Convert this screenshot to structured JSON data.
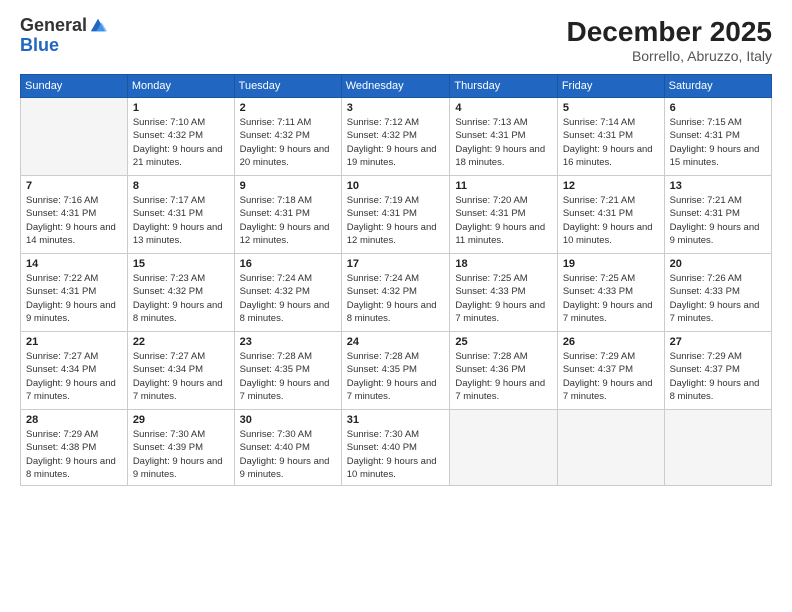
{
  "logo": {
    "general": "General",
    "blue": "Blue"
  },
  "header": {
    "month_year": "December 2025",
    "location": "Borrello, Abruzzo, Italy"
  },
  "weekdays": [
    "Sunday",
    "Monday",
    "Tuesday",
    "Wednesday",
    "Thursday",
    "Friday",
    "Saturday"
  ],
  "weeks": [
    [
      {
        "day": "",
        "empty": true
      },
      {
        "day": "1",
        "sunrise": "7:10 AM",
        "sunset": "4:32 PM",
        "daylight": "9 hours and 21 minutes."
      },
      {
        "day": "2",
        "sunrise": "7:11 AM",
        "sunset": "4:32 PM",
        "daylight": "9 hours and 20 minutes."
      },
      {
        "day": "3",
        "sunrise": "7:12 AM",
        "sunset": "4:32 PM",
        "daylight": "9 hours and 19 minutes."
      },
      {
        "day": "4",
        "sunrise": "7:13 AM",
        "sunset": "4:31 PM",
        "daylight": "9 hours and 18 minutes."
      },
      {
        "day": "5",
        "sunrise": "7:14 AM",
        "sunset": "4:31 PM",
        "daylight": "9 hours and 16 minutes."
      },
      {
        "day": "6",
        "sunrise": "7:15 AM",
        "sunset": "4:31 PM",
        "daylight": "9 hours and 15 minutes."
      }
    ],
    [
      {
        "day": "7",
        "sunrise": "7:16 AM",
        "sunset": "4:31 PM",
        "daylight": "9 hours and 14 minutes."
      },
      {
        "day": "8",
        "sunrise": "7:17 AM",
        "sunset": "4:31 PM",
        "daylight": "9 hours and 13 minutes."
      },
      {
        "day": "9",
        "sunrise": "7:18 AM",
        "sunset": "4:31 PM",
        "daylight": "9 hours and 12 minutes."
      },
      {
        "day": "10",
        "sunrise": "7:19 AM",
        "sunset": "4:31 PM",
        "daylight": "9 hours and 12 minutes."
      },
      {
        "day": "11",
        "sunrise": "7:20 AM",
        "sunset": "4:31 PM",
        "daylight": "9 hours and 11 minutes."
      },
      {
        "day": "12",
        "sunrise": "7:21 AM",
        "sunset": "4:31 PM",
        "daylight": "9 hours and 10 minutes."
      },
      {
        "day": "13",
        "sunrise": "7:21 AM",
        "sunset": "4:31 PM",
        "daylight": "9 hours and 9 minutes."
      }
    ],
    [
      {
        "day": "14",
        "sunrise": "7:22 AM",
        "sunset": "4:31 PM",
        "daylight": "9 hours and 9 minutes."
      },
      {
        "day": "15",
        "sunrise": "7:23 AM",
        "sunset": "4:32 PM",
        "daylight": "9 hours and 8 minutes."
      },
      {
        "day": "16",
        "sunrise": "7:24 AM",
        "sunset": "4:32 PM",
        "daylight": "9 hours and 8 minutes."
      },
      {
        "day": "17",
        "sunrise": "7:24 AM",
        "sunset": "4:32 PM",
        "daylight": "9 hours and 8 minutes."
      },
      {
        "day": "18",
        "sunrise": "7:25 AM",
        "sunset": "4:33 PM",
        "daylight": "9 hours and 7 minutes."
      },
      {
        "day": "19",
        "sunrise": "7:25 AM",
        "sunset": "4:33 PM",
        "daylight": "9 hours and 7 minutes."
      },
      {
        "day": "20",
        "sunrise": "7:26 AM",
        "sunset": "4:33 PM",
        "daylight": "9 hours and 7 minutes."
      }
    ],
    [
      {
        "day": "21",
        "sunrise": "7:27 AM",
        "sunset": "4:34 PM",
        "daylight": "9 hours and 7 minutes."
      },
      {
        "day": "22",
        "sunrise": "7:27 AM",
        "sunset": "4:34 PM",
        "daylight": "9 hours and 7 minutes."
      },
      {
        "day": "23",
        "sunrise": "7:28 AM",
        "sunset": "4:35 PM",
        "daylight": "9 hours and 7 minutes."
      },
      {
        "day": "24",
        "sunrise": "7:28 AM",
        "sunset": "4:35 PM",
        "daylight": "9 hours and 7 minutes."
      },
      {
        "day": "25",
        "sunrise": "7:28 AM",
        "sunset": "4:36 PM",
        "daylight": "9 hours and 7 minutes."
      },
      {
        "day": "26",
        "sunrise": "7:29 AM",
        "sunset": "4:37 PM",
        "daylight": "9 hours and 7 minutes."
      },
      {
        "day": "27",
        "sunrise": "7:29 AM",
        "sunset": "4:37 PM",
        "daylight": "9 hours and 8 minutes."
      }
    ],
    [
      {
        "day": "28",
        "sunrise": "7:29 AM",
        "sunset": "4:38 PM",
        "daylight": "9 hours and 8 minutes."
      },
      {
        "day": "29",
        "sunrise": "7:30 AM",
        "sunset": "4:39 PM",
        "daylight": "9 hours and 9 minutes."
      },
      {
        "day": "30",
        "sunrise": "7:30 AM",
        "sunset": "4:40 PM",
        "daylight": "9 hours and 9 minutes."
      },
      {
        "day": "31",
        "sunrise": "7:30 AM",
        "sunset": "4:40 PM",
        "daylight": "9 hours and 10 minutes."
      },
      {
        "day": "",
        "empty": true
      },
      {
        "day": "",
        "empty": true
      },
      {
        "day": "",
        "empty": true
      }
    ]
  ],
  "labels": {
    "sunrise": "Sunrise:",
    "sunset": "Sunset:",
    "daylight": "Daylight:"
  }
}
